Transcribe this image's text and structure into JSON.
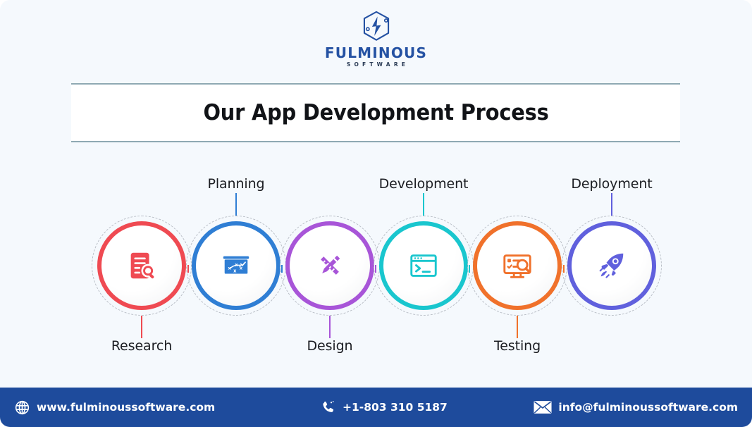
{
  "brand": {
    "logo_icon": "hexagon-lightning-logo-icon",
    "name": "FULMINOUS",
    "tagline": "SOFTWARE",
    "name_color": "#2552a3",
    "tagline_color": "#2a3b55"
  },
  "header": {
    "title": "Our App Development Process"
  },
  "process": {
    "steps": [
      {
        "label": "Research",
        "label_position": "bottom",
        "color": "#ef4a52",
        "icon": "document-search-icon"
      },
      {
        "label": "Planning",
        "label_position": "top",
        "color": "#2f7ed4",
        "icon": "strategy-board-icon"
      },
      {
        "label": "Design",
        "label_position": "bottom",
        "color": "#a855d8",
        "icon": "pencil-ruler-icon"
      },
      {
        "label": "Development",
        "label_position": "top",
        "color": "#19c6ce",
        "icon": "terminal-window-icon"
      },
      {
        "label": "Testing",
        "label_position": "bottom",
        "color": "#f0712b",
        "icon": "monitor-test-icon"
      },
      {
        "label": "Deployment",
        "label_position": "top",
        "color": "#6060dd",
        "icon": "rocket-icon"
      }
    ]
  },
  "footer": {
    "background": "#1e4b9c",
    "website": "www.fulminoussoftware.com",
    "website_icon": "globe-icon",
    "phone": "+1-803 310 5187",
    "phone_icon": "phone-icon",
    "email": "info@fulminoussoftware.com",
    "email_icon": "envelope-icon"
  }
}
